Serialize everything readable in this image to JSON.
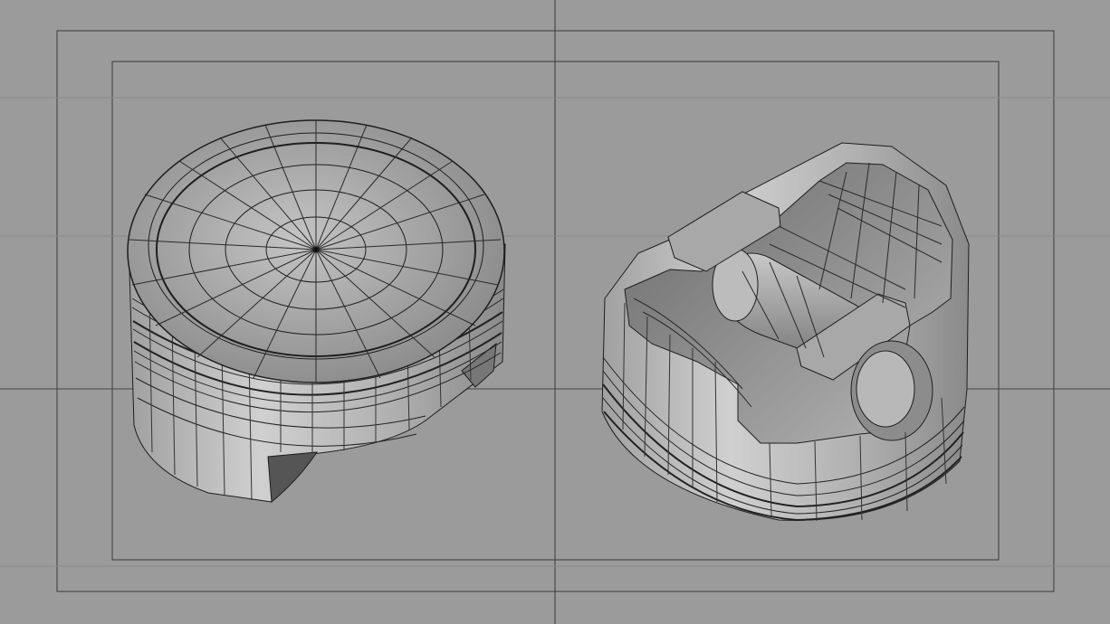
{
  "viewport": {
    "background": "#9b9b9b",
    "wire_color": "#1e1e1e",
    "guide_color": "#3a3a3a"
  },
  "models": [
    {
      "name": "piston-top-view",
      "icon": "piston-crown-icon"
    },
    {
      "name": "piston-bottom-view",
      "icon": "piston-underside-icon"
    }
  ]
}
